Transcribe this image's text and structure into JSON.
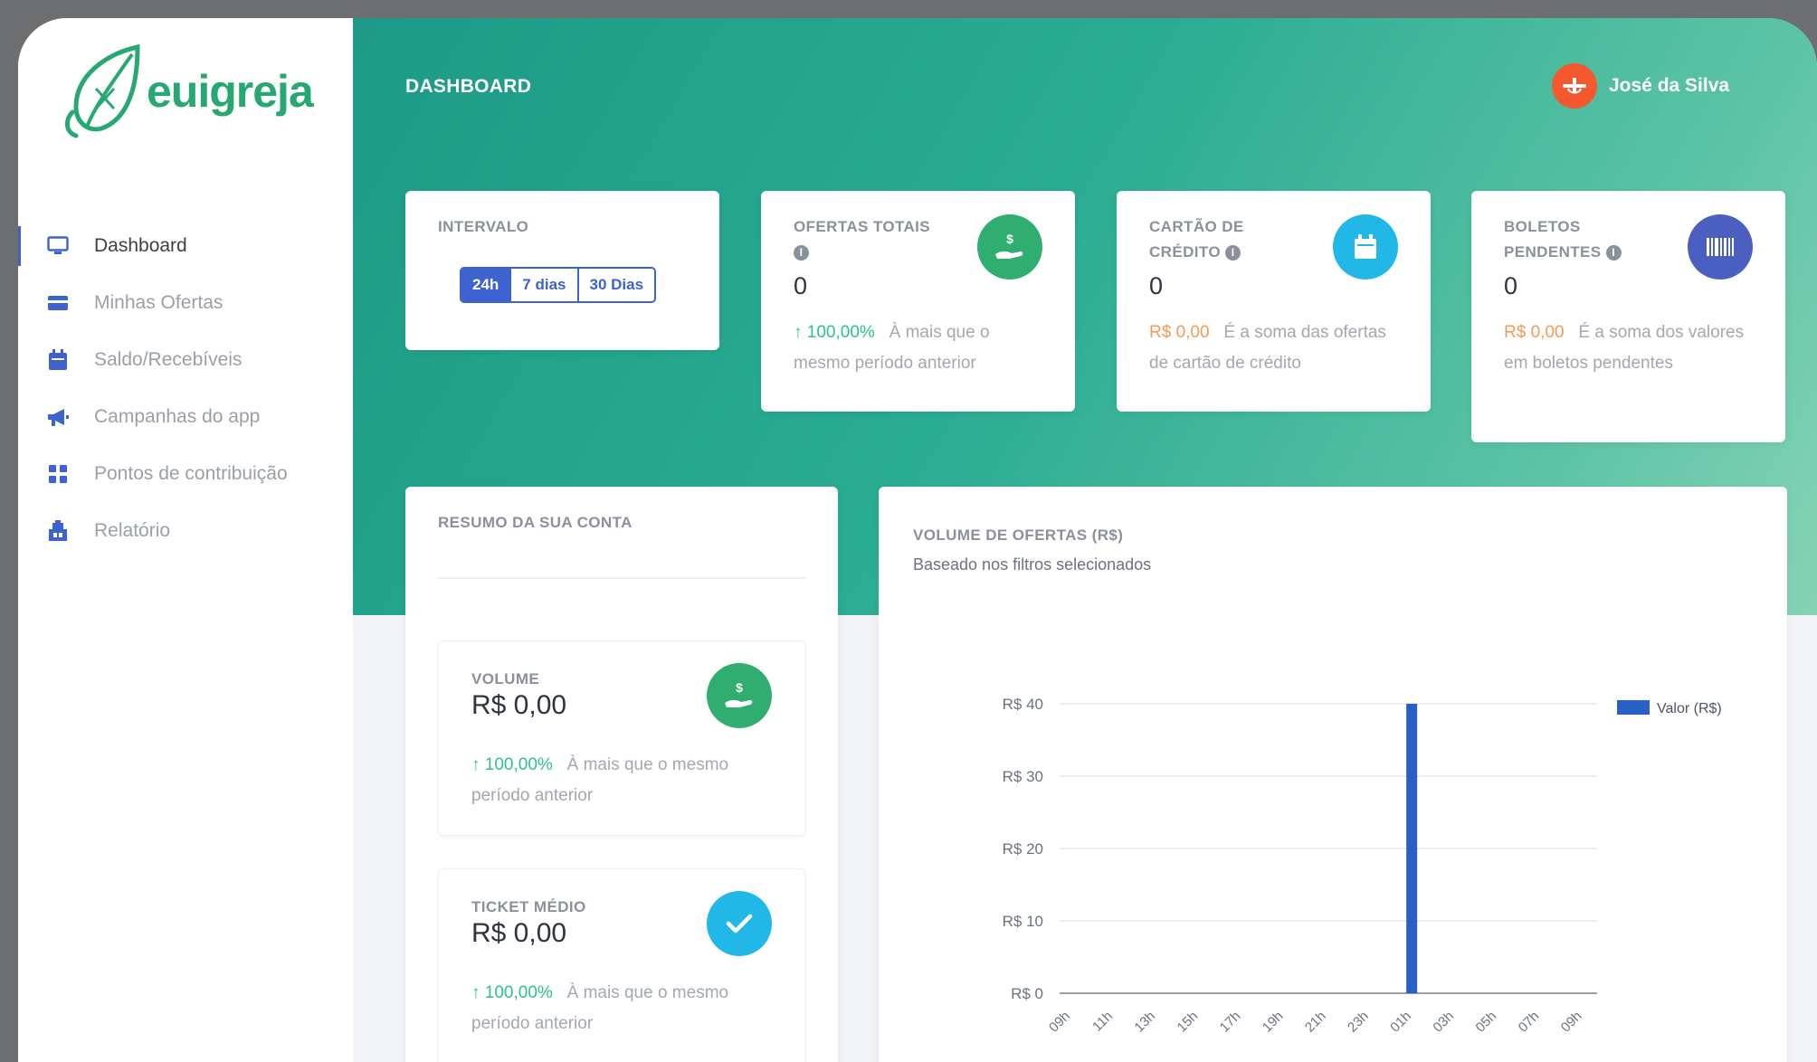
{
  "app": {
    "logo_text": "euigreja",
    "page_title": "DASHBOARD",
    "user_name": "José da Silva"
  },
  "sidebar": {
    "items": [
      {
        "label": "Dashboard",
        "icon": "monitor-icon",
        "active": true
      },
      {
        "label": "Minhas Ofertas",
        "icon": "credit-card-icon"
      },
      {
        "label": "Saldo/Recebíveis",
        "icon": "calendar-icon"
      },
      {
        "label": "Campanhas do app",
        "icon": "megaphone-icon"
      },
      {
        "label": "Pontos de contribuição",
        "icon": "grid-icon"
      },
      {
        "label": "Relatório",
        "icon": "report-icon"
      }
    ]
  },
  "interval": {
    "title": "INTERVALO",
    "options": [
      "24h",
      "7 dias",
      "30 Dias"
    ],
    "selected": "24h"
  },
  "stats": [
    {
      "title": "OFERTAS TOTAIS",
      "value": "0",
      "highlight": "100,00%",
      "description": "À mais que o mesmo período anterior",
      "icon": "hand-dollar-icon",
      "icon_color": "#2fae6f"
    },
    {
      "title": "CARTÃO DE CRÉDITO",
      "value": "0",
      "highlight": "R$ 0,00",
      "description": "É a soma das ofertas de cartão de crédito",
      "icon": "calendar-icon",
      "icon_color": "#21b7e6"
    },
    {
      "title": "BOLETOS PENDENTES",
      "value": "0",
      "highlight": "R$ 0,00",
      "description": "É a soma dos valores em boletos pendentes",
      "icon": "barcode-icon",
      "icon_color": "#4a5fbf"
    }
  ],
  "summary": {
    "title": "RESUMO DA SUA CONTA",
    "items": [
      {
        "title": "VOLUME",
        "value": "R$ 0,00",
        "highlight": "100,00%",
        "description": "À mais que o mesmo período anterior",
        "icon": "hand-dollar-icon",
        "icon_color": "#2fae6f"
      },
      {
        "title": "TICKET MÉDIO",
        "value": "R$ 0,00",
        "highlight": "100,00%",
        "description": "À mais que o mesmo período anterior",
        "icon": "check-icon",
        "icon_color": "#21b7e6"
      }
    ]
  },
  "chart_panel": {
    "title": "VOLUME DE OFERTAS (R$)",
    "subtitle": "Baseado nos filtros selecionados"
  },
  "chart_data": {
    "type": "bar",
    "categories": [
      "09h",
      "11h",
      "13h",
      "15h",
      "17h",
      "19h",
      "21h",
      "23h",
      "01h",
      "03h",
      "05h",
      "07h",
      "09h"
    ],
    "series": [
      {
        "name": "Valor (R$)",
        "values": [
          0,
          0,
          0,
          0,
          0,
          0,
          0,
          0,
          40,
          0,
          0,
          0,
          0
        ],
        "color": "#2860c4"
      }
    ],
    "ylim": [
      0,
      40
    ],
    "yticks": [
      0,
      10,
      20,
      30,
      40
    ],
    "ytick_labels": [
      "R$ 0",
      "R$ 10",
      "R$ 20",
      "R$ 30",
      "R$ 40"
    ],
    "grid": true,
    "legend": "top-right"
  }
}
